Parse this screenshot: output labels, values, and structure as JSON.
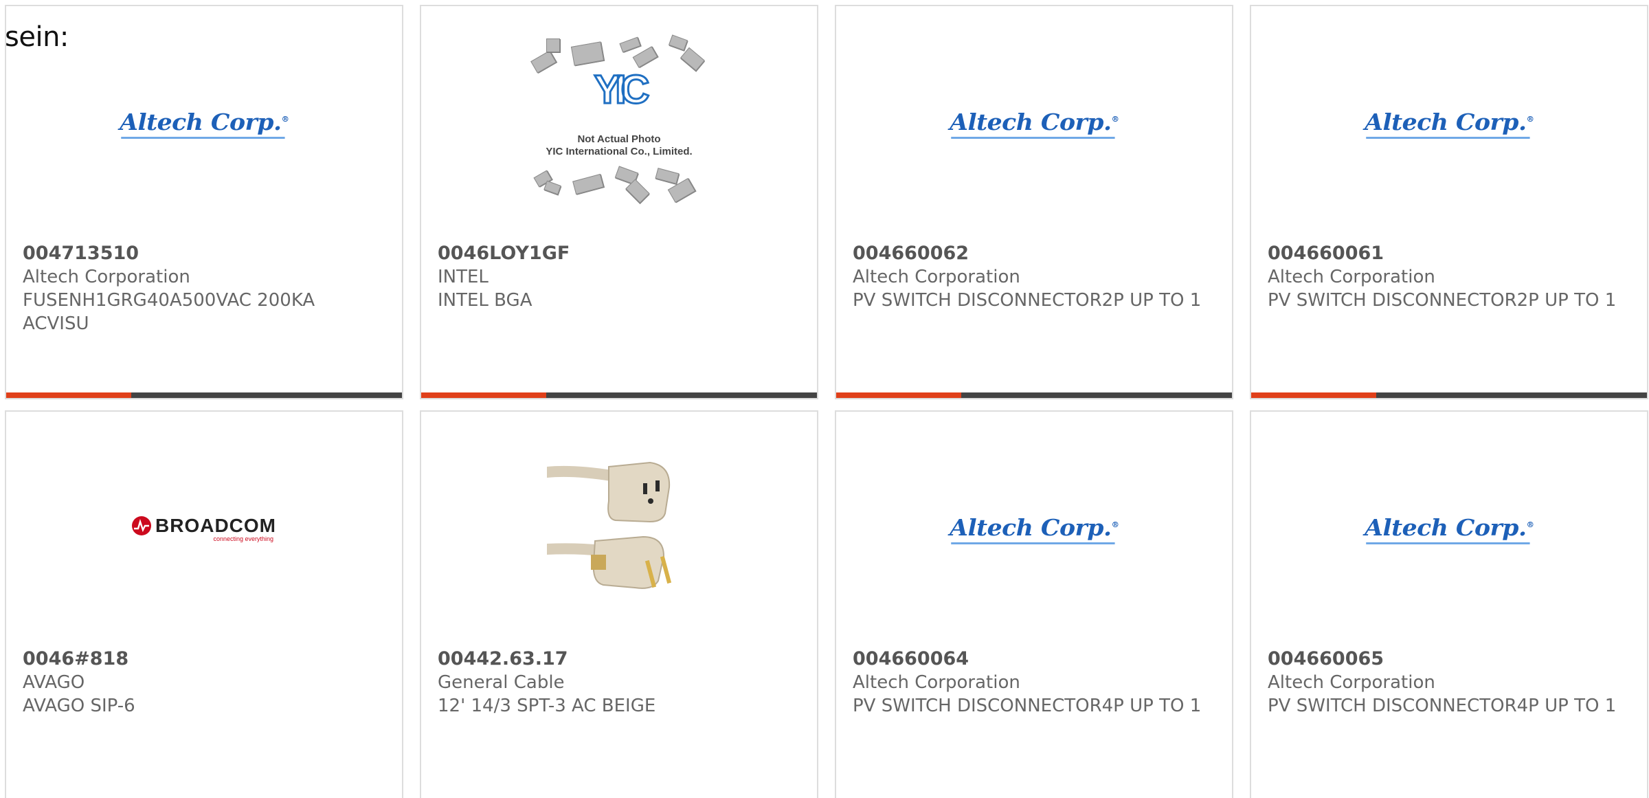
{
  "intro_text": "sein:",
  "colors": {
    "accent": "#e0401a",
    "bar": "#444444",
    "text": "#666666",
    "altech_blue": "#1d60b8",
    "broadcom_red": "#cc0a1e"
  },
  "cards": [
    {
      "part_number": "004713510",
      "manufacturer": "Altech Corporation",
      "description": "FUSENH1GRG40A500VAC 200KA ACVISU",
      "image": {
        "type": "altech-logo",
        "text": "Altech Corp."
      }
    },
    {
      "part_number": "0046LOY1GF",
      "manufacturer": "INTEL",
      "description": "INTEL BGA",
      "image": {
        "type": "yic-placeholder",
        "logo_text": "YIC",
        "caption_line1": "Not Actual Photo",
        "caption_line2": "YIC International Co., Limited."
      }
    },
    {
      "part_number": "004660062",
      "manufacturer": "Altech Corporation",
      "description": "PV SWITCH DISCONNECTOR2P UP TO 1",
      "image": {
        "type": "altech-logo",
        "text": "Altech Corp."
      }
    },
    {
      "part_number": "004660061",
      "manufacturer": "Altech Corporation",
      "description": "PV SWITCH DISCONNECTOR2P UP TO 1",
      "image": {
        "type": "altech-logo",
        "text": "Altech Corp."
      }
    },
    {
      "part_number": "0046#818",
      "manufacturer": "AVAGO",
      "description": "AVAGO SIP-6",
      "image": {
        "type": "broadcom-logo",
        "text": "BROADCOM",
        "tagline": "connecting everything"
      }
    },
    {
      "part_number": "00442.63.17",
      "manufacturer": "General Cable",
      "description": "12' 14/3 SPT-3 AC BEIGE",
      "image": {
        "type": "extension-cord-photo"
      }
    },
    {
      "part_number": "004660064",
      "manufacturer": "Altech Corporation",
      "description": "PV SWITCH DISCONNECTOR4P UP TO 1",
      "image": {
        "type": "altech-logo",
        "text": "Altech Corp."
      }
    },
    {
      "part_number": "004660065",
      "manufacturer": "Altech Corporation",
      "description": "PV SWITCH DISCONNECTOR4P UP TO 1",
      "image": {
        "type": "altech-logo",
        "text": "Altech Corp."
      }
    }
  ]
}
